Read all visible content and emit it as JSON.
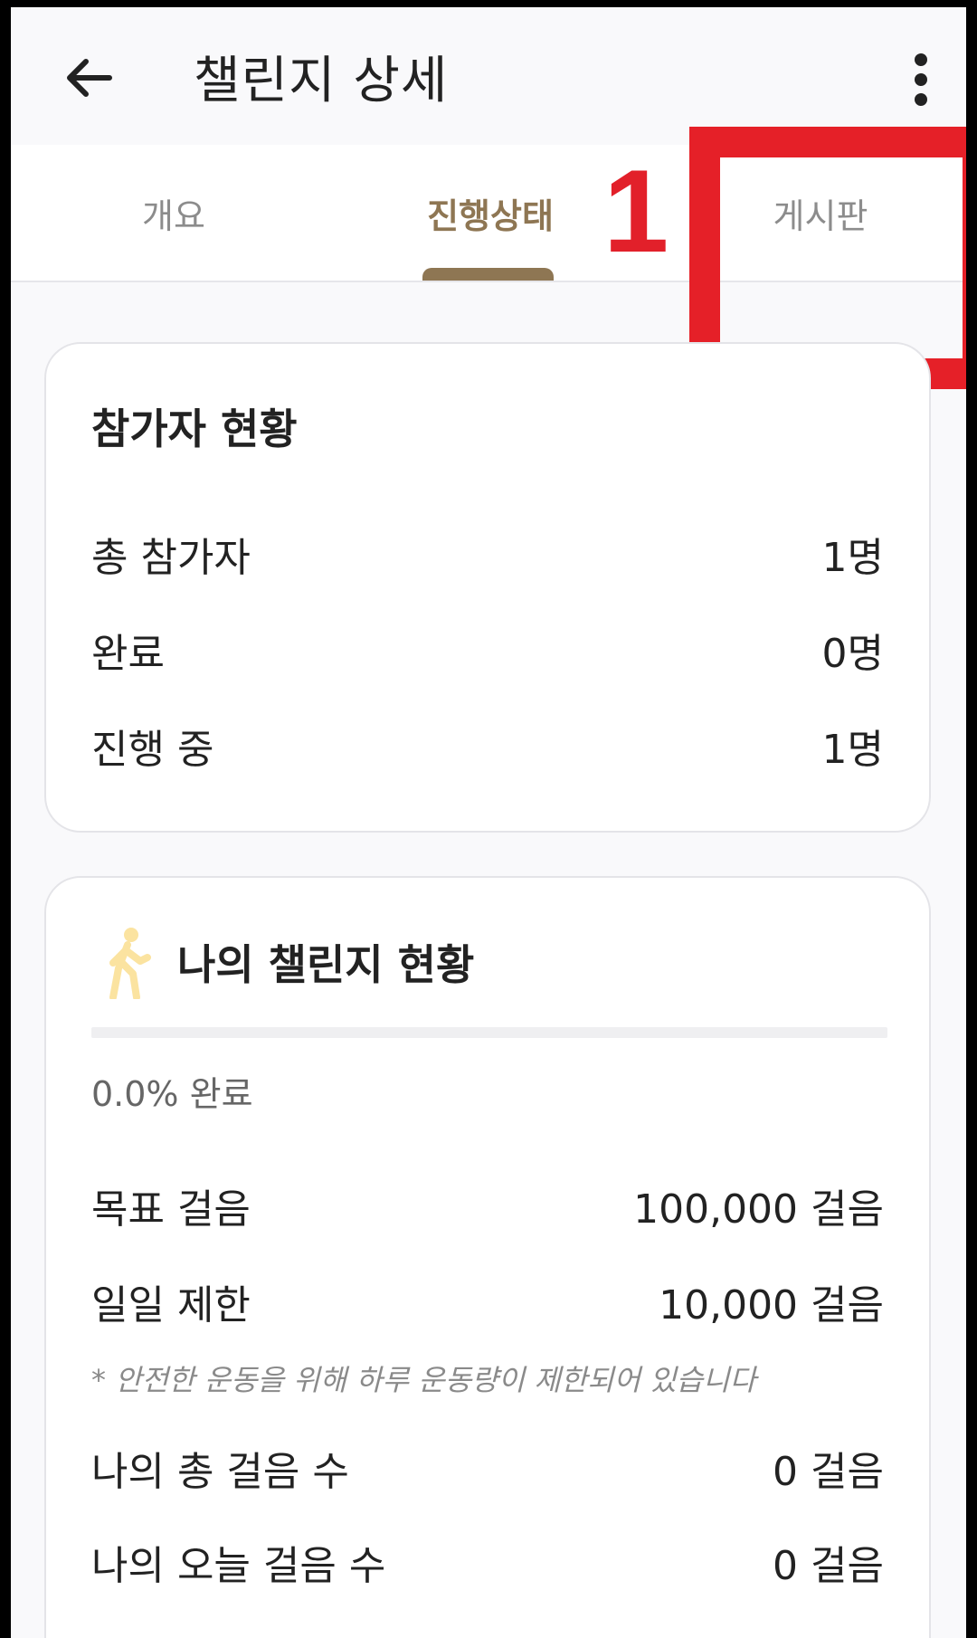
{
  "appbar": {
    "title": "챌린지 상세",
    "back_icon": "arrow-left-icon",
    "more_icon": "more-vertical-icon"
  },
  "tabs": [
    {
      "label": "개요",
      "active": false
    },
    {
      "label": "진행상태",
      "active": true
    },
    {
      "label": "게시판",
      "active": false
    }
  ],
  "annotation": {
    "number": "1",
    "color": "#e52028"
  },
  "participants": {
    "title": "참가자 현황",
    "rows": [
      {
        "label": "총 참가자",
        "value": "1명"
      },
      {
        "label": "완료",
        "value": "0명"
      },
      {
        "label": "진행 중",
        "value": "1명"
      }
    ]
  },
  "my_challenge": {
    "icon": "walking-person-icon",
    "title": "나의 챌린지 현황",
    "progress_percent": 0.0,
    "progress_text": "0.0% 완료",
    "rows": [
      {
        "label": "목표 걸음",
        "value": "100,000 걸음"
      },
      {
        "label": "일일 제한",
        "value": "10,000 걸음"
      }
    ],
    "note": "* 안전한 운동을 위해 하루 운동량이 제한되어 있습니다",
    "rows2": [
      {
        "label": "나의 총 걸음 수",
        "value": "0 걸음"
      },
      {
        "label": "나의 오늘 걸음 수",
        "value": "0 걸음"
      }
    ]
  },
  "colors": {
    "accent": "#8e7653",
    "background": "#f9f9fb",
    "icon_yellow": "#fbe3a0"
  }
}
